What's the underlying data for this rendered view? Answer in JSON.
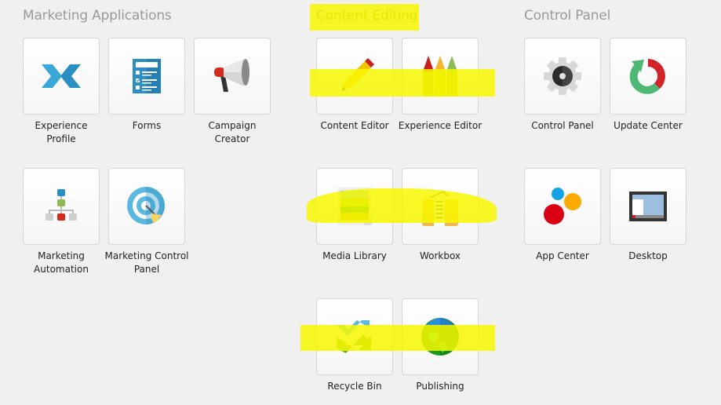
{
  "groups": [
    {
      "title": "Marketing Applications",
      "apps": [
        {
          "label": "Experience Profile",
          "icon": "experience-profile-icon"
        },
        {
          "label": "Forms",
          "icon": "forms-icon"
        },
        {
          "label": "Campaign Creator",
          "icon": "megaphone-icon"
        },
        {
          "label": "Marketing Automation",
          "icon": "org-chart-icon"
        },
        {
          "label": "Marketing Control Panel",
          "icon": "target-icon"
        }
      ]
    },
    {
      "title": "Content Editing",
      "apps": [
        {
          "label": "Content Editor",
          "icon": "pencil-icon"
        },
        {
          "label": "Experience Editor",
          "icon": "crayons-icon"
        },
        {
          "label": "Media Library",
          "icon": "image-icon"
        },
        {
          "label": "Workbox",
          "icon": "workbox-icon"
        },
        {
          "label": "Recycle Bin",
          "icon": "recycle-icon"
        },
        {
          "label": "Publishing",
          "icon": "globe-icon"
        }
      ]
    },
    {
      "title": "Control Panel",
      "apps": [
        {
          "label": "Control Panel",
          "icon": "gear-icon"
        },
        {
          "label": "Update Center",
          "icon": "update-icon"
        },
        {
          "label": "App Center",
          "icon": "app-center-icon"
        },
        {
          "label": "Desktop",
          "icon": "desktop-icon"
        }
      ]
    }
  ],
  "colors": {
    "highlight": "#f7f700",
    "group_title": "#9a9a9a",
    "background": "#f0f0f0"
  }
}
